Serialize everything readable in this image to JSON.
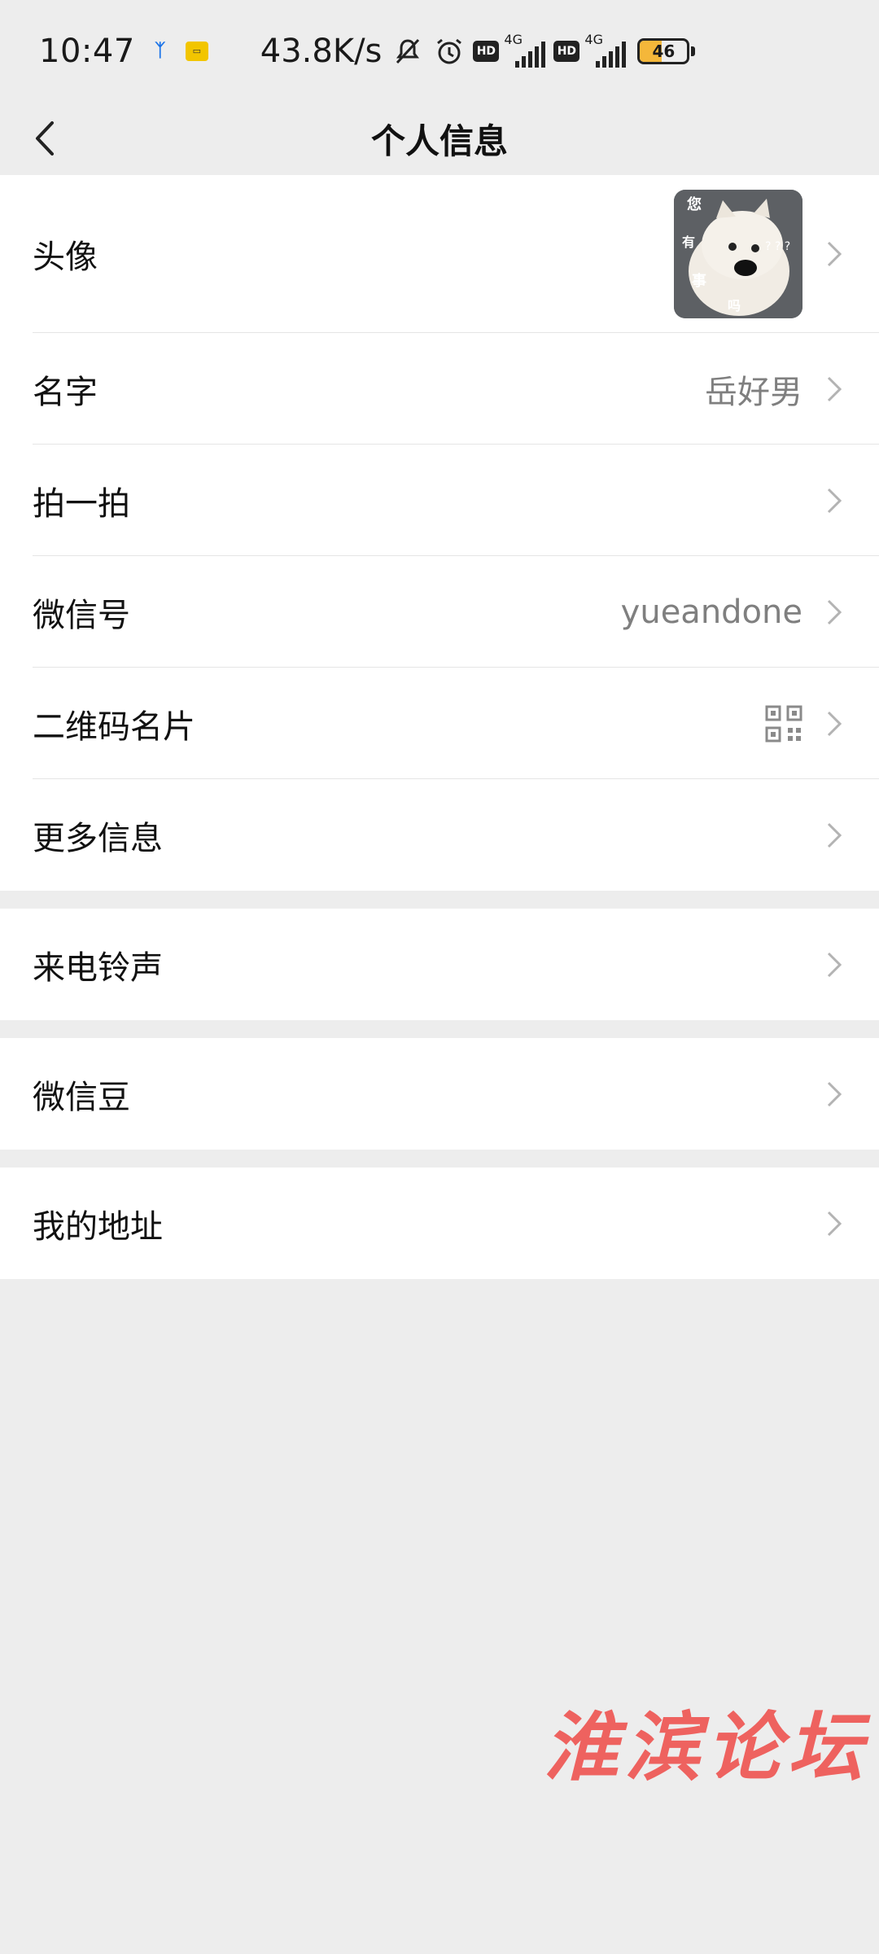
{
  "status_bar": {
    "time": "10:47",
    "net_speed": "43.8K/s",
    "battery_level": "46",
    "battery_fraction": 0.46,
    "signal_tag_1": "4G",
    "signal_tag_2": "4G",
    "hd_label_1": "HD",
    "hd_label_2": "HD"
  },
  "nav": {
    "title": "个人信息"
  },
  "profile_rows": [
    {
      "label": "头像"
    },
    {
      "label": "名字",
      "value": "岳好男"
    },
    {
      "label": "拍一拍"
    },
    {
      "label": "微信号",
      "value": "yueandone"
    },
    {
      "label": "二维码名片"
    },
    {
      "label": "更多信息"
    }
  ],
  "avatar_text": {
    "c1": "您",
    "c2": "有",
    "c3": "事",
    "c4": "吗",
    "q": "? ? ?"
  },
  "ringtone": {
    "label": "来电铃声"
  },
  "wechat_beans": {
    "label": "微信豆"
  },
  "address": {
    "label": "我的地址"
  },
  "watermark": "淮滨论坛"
}
